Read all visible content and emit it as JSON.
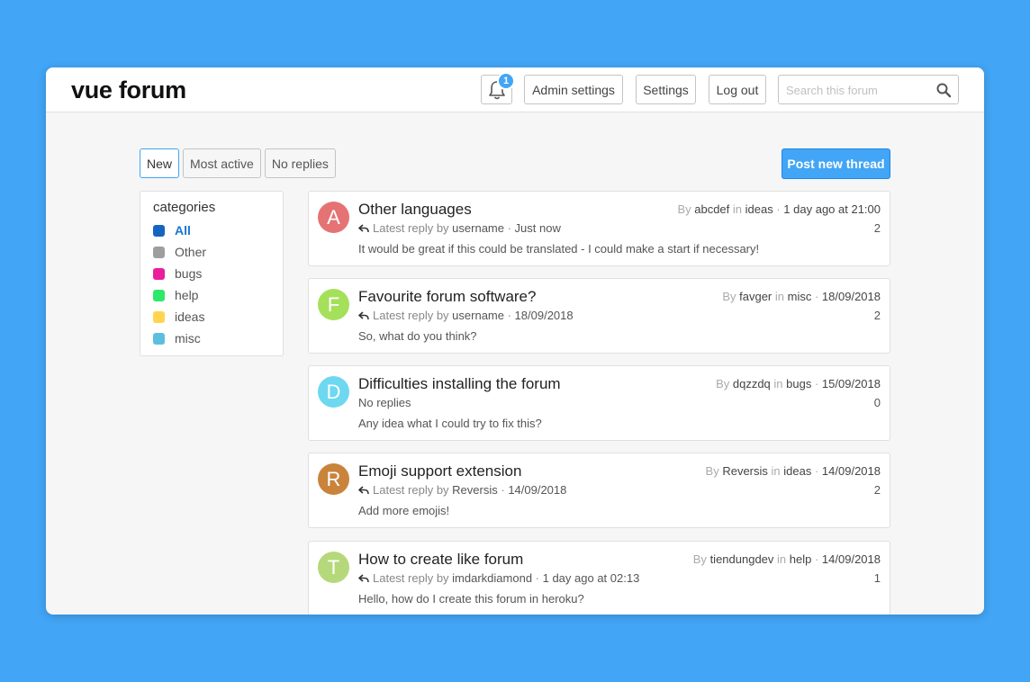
{
  "header": {
    "logo": "vue forum",
    "notification_count": "1",
    "admin_settings_label": "Admin settings",
    "settings_label": "Settings",
    "logout_label": "Log out",
    "search_placeholder": "Search this forum"
  },
  "tabs": [
    {
      "label": "New",
      "active": true
    },
    {
      "label": "Most active",
      "active": false
    },
    {
      "label": "No replies",
      "active": false
    }
  ],
  "post_button_label": "Post new thread",
  "categories": {
    "title": "categories",
    "items": [
      {
        "label": "All",
        "color": "#1565c0",
        "active": true
      },
      {
        "label": "Other",
        "color": "#9e9e9e",
        "active": false
      },
      {
        "label": "bugs",
        "color": "#e91e9c",
        "active": false
      },
      {
        "label": "help",
        "color": "#2ee86a",
        "active": false
      },
      {
        "label": "ideas",
        "color": "#ffd54f",
        "active": false
      },
      {
        "label": "misc",
        "color": "#5bc0de",
        "active": false
      }
    ]
  },
  "threads": [
    {
      "avatar_letter": "A",
      "avatar_color": "#e57373",
      "title": "Other languages",
      "reply_prefix": "Latest reply by",
      "reply_user": "username",
      "reply_time": "Just now",
      "has_reply": true,
      "body": "It would be great if this could be translated - I could make a start if necessary!",
      "by_label": "By",
      "author": "abcdef",
      "in_label": "in",
      "category": "ideas",
      "date": "1 day ago at 21:00",
      "replies": "2"
    },
    {
      "avatar_letter": "F",
      "avatar_color": "#a5e05a",
      "title": "Favourite forum software?",
      "reply_prefix": "Latest reply by",
      "reply_user": "username",
      "reply_time": "18/09/2018",
      "has_reply": true,
      "body": "So, what do you think?",
      "by_label": "By",
      "author": "favger",
      "in_label": "in",
      "category": "misc",
      "date": "18/09/2018",
      "replies": "2"
    },
    {
      "avatar_letter": "D",
      "avatar_color": "#6dd8ef",
      "title": "Difficulties installing the forum",
      "no_replies_label": "No replies",
      "has_reply": false,
      "body": "Any idea what I could try to fix this?",
      "by_label": "By",
      "author": "dqzzdq",
      "in_label": "in",
      "category": "bugs",
      "date": "15/09/2018",
      "replies": "0"
    },
    {
      "avatar_letter": "R",
      "avatar_color": "#c9833b",
      "title": "Emoji support extension",
      "reply_prefix": "Latest reply by",
      "reply_user": "Reversis",
      "reply_time": "14/09/2018",
      "has_reply": true,
      "body": "Add more emojis!",
      "by_label": "By",
      "author": "Reversis",
      "in_label": "in",
      "category": "ideas",
      "date": "14/09/2018",
      "replies": "2"
    },
    {
      "avatar_letter": "T",
      "avatar_color": "#b5d97a",
      "title": "How to create like forum",
      "reply_prefix": "Latest reply by",
      "reply_user": "imdarkdiamond",
      "reply_time": "1 day ago at 02:13",
      "has_reply": true,
      "body": "Hello, how do I create this forum in heroku?",
      "by_label": "By",
      "author": "tiendungdev",
      "in_label": "in",
      "category": "help",
      "date": "14/09/2018",
      "replies": "1"
    }
  ]
}
